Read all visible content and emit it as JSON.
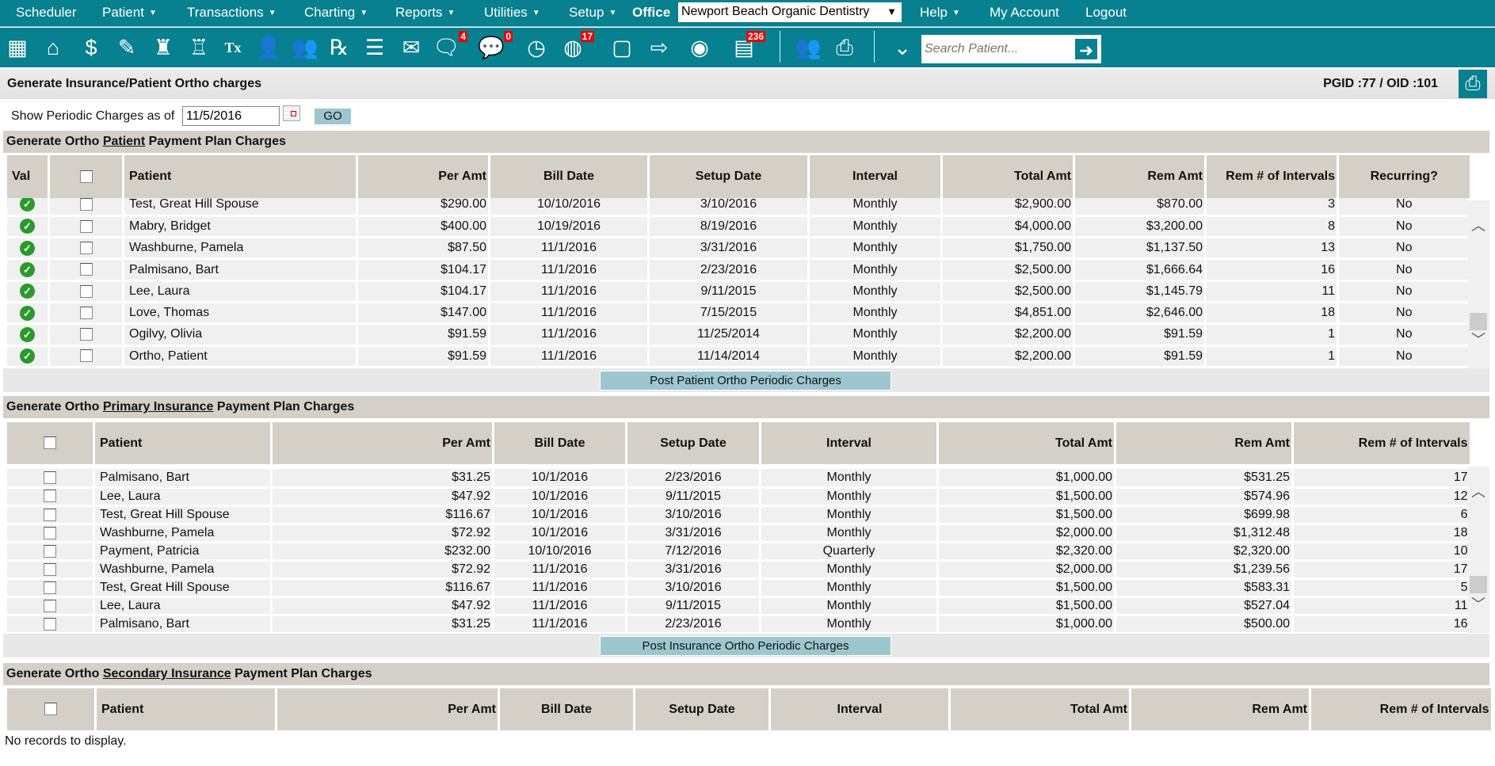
{
  "menu": {
    "items": [
      {
        "label": "Scheduler",
        "caret": false
      },
      {
        "label": "Patient",
        "caret": true
      },
      {
        "label": "Transactions",
        "caret": true
      },
      {
        "label": "Charting",
        "caret": true
      },
      {
        "label": "Reports",
        "caret": true
      },
      {
        "label": "Utilities",
        "caret": true
      },
      {
        "label": "Setup",
        "caret": true
      }
    ],
    "office_label": "Office",
    "office_value": "Newport Beach Organic Dentistry",
    "help": "Help",
    "my_account": "My Account",
    "logout": "Logout"
  },
  "toolbar": {
    "icons": [
      {
        "name": "calendar-grid-icon",
        "glyph": "▦"
      },
      {
        "name": "home-icon",
        "glyph": "⌂"
      },
      {
        "name": "dollar-transfer-icon",
        "glyph": "$"
      },
      {
        "name": "edit-list-icon",
        "glyph": "✎"
      },
      {
        "name": "tooth-icon",
        "glyph": "♜"
      },
      {
        "name": "tooth-crown-icon",
        "glyph": "♖"
      },
      {
        "name": "treatment-tx-icon",
        "glyph": "Tx"
      },
      {
        "name": "add-patient-icon",
        "glyph": "👤"
      },
      {
        "name": "add-family-icon",
        "glyph": "👥"
      },
      {
        "name": "prescription-rx-icon",
        "glyph": "℞"
      },
      {
        "name": "notepad-icon",
        "glyph": "☰"
      },
      {
        "name": "mail-icon",
        "glyph": "✉"
      },
      {
        "name": "messages-icon",
        "glyph": "🗨",
        "badge": "4"
      },
      {
        "name": "chat-icon",
        "glyph": "💬",
        "badge": "0"
      },
      {
        "name": "clock-icon",
        "glyph": "◷"
      },
      {
        "name": "online-patients-icon",
        "glyph": "◍",
        "badge": "17"
      },
      {
        "name": "xray-icon",
        "glyph": "▢"
      },
      {
        "name": "export-icon",
        "glyph": "⇨"
      },
      {
        "name": "globe-icon",
        "glyph": "◉"
      },
      {
        "name": "claims-icon",
        "glyph": "▤",
        "badge": "236"
      },
      {
        "name": "users-icon",
        "glyph": "👥"
      },
      {
        "name": "print-forms-icon",
        "glyph": "⎙"
      },
      {
        "name": "expand-chevron-icon",
        "glyph": "⌄"
      }
    ],
    "search_placeholder": "Search Patient..."
  },
  "header": {
    "title": "Generate Insurance/Patient Ortho charges",
    "ids": "PGID :77  /  OID :101"
  },
  "filter": {
    "label": "Show Periodic Charges as of",
    "date": "11/5/2016",
    "go": "GO"
  },
  "patient_section": {
    "title_pre": "Generate Ortho ",
    "title_u": "Patient",
    "title_post": " Payment Plan Charges",
    "columns": [
      "Val",
      "",
      "Patient",
      "Per Amt",
      "Bill Date",
      "Setup Date",
      "Interval",
      "Total Amt",
      "Rem Amt",
      "Rem # of Intervals",
      "Recurring?"
    ],
    "rows": [
      [
        "Test, Great Hill Spouse",
        "$290.00",
        "10/10/2016",
        "3/10/2016",
        "Monthly",
        "$2,900.00",
        "$870.00",
        "3",
        "No"
      ],
      [
        "Mabry, Bridget",
        "$400.00",
        "10/19/2016",
        "8/19/2016",
        "Monthly",
        "$4,000.00",
        "$3,200.00",
        "8",
        "No"
      ],
      [
        "Washburne, Pamela",
        "$87.50",
        "11/1/2016",
        "3/31/2016",
        "Monthly",
        "$1,750.00",
        "$1,137.50",
        "13",
        "No"
      ],
      [
        "Palmisano, Bart",
        "$104.17",
        "11/1/2016",
        "2/23/2016",
        "Monthly",
        "$2,500.00",
        "$1,666.64",
        "16",
        "No"
      ],
      [
        "Lee, Laura",
        "$104.17",
        "11/1/2016",
        "9/11/2015",
        "Monthly",
        "$2,500.00",
        "$1,145.79",
        "11",
        "No"
      ],
      [
        "Love, Thomas",
        "$147.00",
        "11/1/2016",
        "7/15/2015",
        "Monthly",
        "$4,851.00",
        "$2,646.00",
        "18",
        "No"
      ],
      [
        "Ogilvy, Olivia",
        "$91.59",
        "11/1/2016",
        "11/25/2014",
        "Monthly",
        "$2,200.00",
        "$91.59",
        "1",
        "No"
      ],
      [
        "Ortho, Patient",
        "$91.59",
        "11/1/2016",
        "11/14/2014",
        "Monthly",
        "$2,200.00",
        "$91.59",
        "1",
        "No"
      ]
    ],
    "post_button": "Post Patient Ortho Periodic Charges"
  },
  "primary_section": {
    "title_pre": "Generate Ortho ",
    "title_u": "Primary Insurance",
    "title_post": " Payment Plan Charges",
    "columns": [
      "",
      "Patient",
      "Per Amt",
      "Bill Date",
      "Setup Date",
      "Interval",
      "Total Amt",
      "Rem Amt",
      "Rem # of Intervals"
    ],
    "rows": [
      [
        "Palmisano, Bart",
        "$31.25",
        "10/1/2016",
        "2/23/2016",
        "Monthly",
        "$1,000.00",
        "$531.25",
        "17"
      ],
      [
        "Lee, Laura",
        "$47.92",
        "10/1/2016",
        "9/11/2015",
        "Monthly",
        "$1,500.00",
        "$574.96",
        "12"
      ],
      [
        "Test, Great Hill Spouse",
        "$116.67",
        "10/1/2016",
        "3/10/2016",
        "Monthly",
        "$1,500.00",
        "$699.98",
        "6"
      ],
      [
        "Washburne, Pamela",
        "$72.92",
        "10/1/2016",
        "3/31/2016",
        "Monthly",
        "$2,000.00",
        "$1,312.48",
        "18"
      ],
      [
        "Payment, Patricia",
        "$232.00",
        "10/10/2016",
        "7/12/2016",
        "Quarterly",
        "$2,320.00",
        "$2,320.00",
        "10"
      ],
      [
        "Washburne, Pamela",
        "$72.92",
        "11/1/2016",
        "3/31/2016",
        "Monthly",
        "$2,000.00",
        "$1,239.56",
        "17"
      ],
      [
        "Test, Great Hill Spouse",
        "$116.67",
        "11/1/2016",
        "3/10/2016",
        "Monthly",
        "$1,500.00",
        "$583.31",
        "5"
      ],
      [
        "Lee, Laura",
        "$47.92",
        "11/1/2016",
        "9/11/2015",
        "Monthly",
        "$1,500.00",
        "$527.04",
        "11"
      ],
      [
        "Palmisano, Bart",
        "$31.25",
        "11/1/2016",
        "2/23/2016",
        "Monthly",
        "$1,000.00",
        "$500.00",
        "16"
      ]
    ],
    "post_button": "Post Insurance Ortho Periodic Charges"
  },
  "secondary_section": {
    "title_pre": "Generate Ortho ",
    "title_u": "Secondary Insurance",
    "title_post": " Payment Plan Charges",
    "columns": [
      "",
      "Patient",
      "Per Amt",
      "Bill Date",
      "Setup Date",
      "Interval",
      "Total Amt",
      "Rem Amt",
      "Rem # of Intervals"
    ],
    "empty_text": "No records to display."
  }
}
